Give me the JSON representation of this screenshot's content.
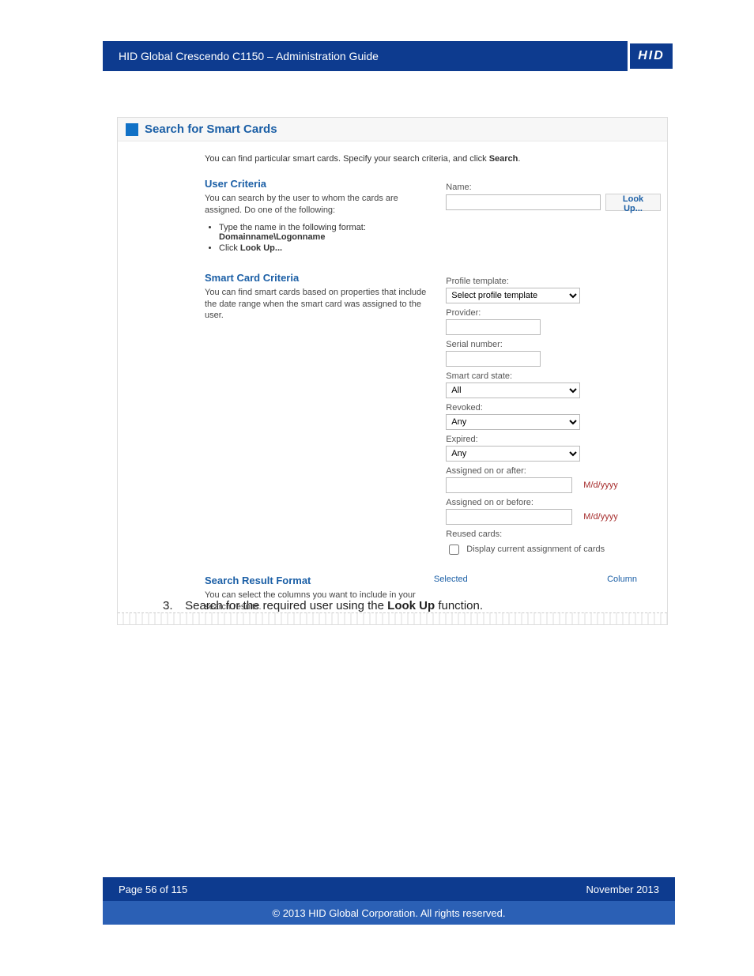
{
  "header": {
    "title": "HID Global Crescendo C1150  – Administration Guide",
    "logo": "HID"
  },
  "screenshot": {
    "title": "Search for Smart Cards",
    "intro_pre": "You can find particular smart cards. Specify your search criteria, and click ",
    "intro_bold": "Search",
    "intro_post": ".",
    "user_criteria": {
      "heading": "User Criteria",
      "desc": "You can search by the user to whom the cards are assigned. Do one of the following:",
      "bullets": {
        "b1a": "Type the name in the following format:",
        "b1b": "Domainname\\Logonname",
        "b2a": "Click ",
        "b2b": "Look Up..."
      },
      "name_label": "Name:",
      "lookup_btn": "Look Up..."
    },
    "smart_card_criteria": {
      "heading": "Smart Card Criteria",
      "desc": "You can find smart cards based on properties that include the date range when the smart card was assigned to the user.",
      "fields": {
        "profile_template_label": "Profile template:",
        "profile_template_value": "Select profile template",
        "provider_label": "Provider:",
        "serial_label": "Serial number:",
        "state_label": "Smart card state:",
        "state_value": "All",
        "revoked_label": "Revoked:",
        "revoked_value": "Any",
        "expired_label": "Expired:",
        "expired_value": "Any",
        "assigned_after_label": "Assigned on or after:",
        "assigned_before_label": "Assigned on or before:",
        "date_hint": "M/d/yyyy",
        "reused_label": "Reused cards:",
        "reused_check": "Display current assignment of cards"
      }
    },
    "result_format": {
      "heading": "Search Result Format",
      "desc": "You can select the columns you want to include in your search results.",
      "col_selected": "Selected",
      "col_column": "Column"
    }
  },
  "step": {
    "number": "3.",
    "text_a": "Search for the required user using the ",
    "text_b": "Look Up",
    "text_c": " function."
  },
  "footer": {
    "page": "Page 56 of 115",
    "date": "November 2013",
    "copyright": "© 2013 HID Global Corporation. All rights reserved."
  }
}
